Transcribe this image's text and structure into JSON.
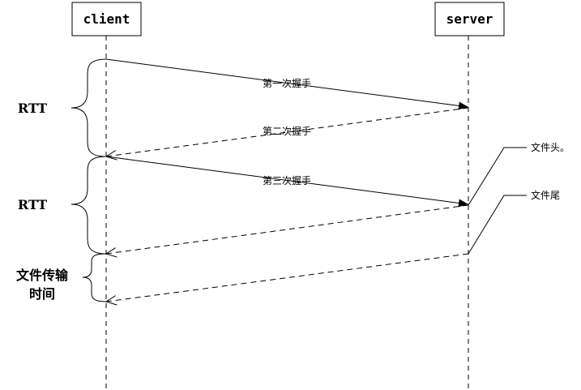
{
  "actors": {
    "client": "client",
    "server": "server"
  },
  "messages": [
    {
      "label": "第一次握手"
    },
    {
      "label": "第二次握手"
    },
    {
      "label": "第三次握手"
    }
  ],
  "braces": [
    {
      "label": "RTT"
    },
    {
      "label": "RTT"
    },
    {
      "label_line1": "文件传输",
      "label_line2": "时间"
    }
  ],
  "callouts": [
    {
      "text": "文件头。"
    },
    {
      "text": "文件尾"
    }
  ]
}
